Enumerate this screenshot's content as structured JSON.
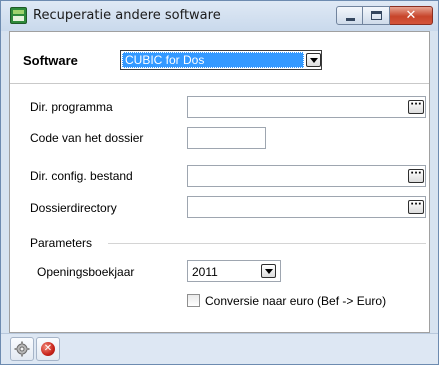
{
  "window": {
    "title": "Recuperatie andere software",
    "close_glyph": "✕"
  },
  "software": {
    "label": "Software",
    "selected": "CUBIC for Dos"
  },
  "fields": {
    "program_dir": {
      "label": "Dir. programma",
      "value": "",
      "browse": "···"
    },
    "dossier_code": {
      "label": "Code van het dossier",
      "value": ""
    },
    "config_file_dir": {
      "label": "Dir. config. bestand",
      "value": "",
      "browse": "···"
    },
    "dossier_directory": {
      "label": "Dossierdirectory",
      "value": "",
      "browse": "···"
    }
  },
  "parameters": {
    "group_label": "Parameters",
    "opening_year_label": "Openingsboekjaar",
    "opening_year_value": "2011",
    "euro_conversion_label": "Conversie naar euro (Bef -> Euro)",
    "euro_conversion_checked": false
  },
  "toolbar": {
    "settings_icon": "gear-icon",
    "cancel_icon": "cancel-icon",
    "cancel_glyph": "✕"
  },
  "colors": {
    "selection": "#3399ff",
    "frame": "#d7e3f0",
    "toolbar": "#dde7f3"
  }
}
